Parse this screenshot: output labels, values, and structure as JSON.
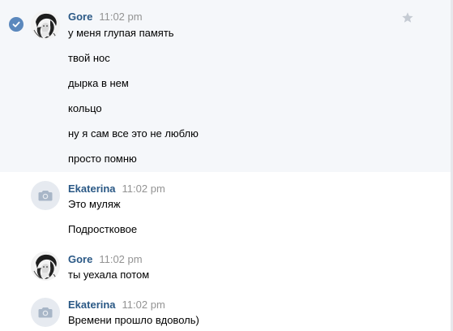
{
  "colors": {
    "author": "#2a5885",
    "time": "#939393",
    "text": "#000000",
    "selected_background": "#f5f7fa",
    "check": "#5b88bd",
    "star": "#c5cbd3",
    "camera_avatar": "#e6eaf0"
  },
  "messages": [
    {
      "author": "Gore",
      "time": "11:02 pm",
      "avatar": "photo",
      "selected": true,
      "lines": [
        "у меня глупая память",
        "твой нос",
        "дырка в нем",
        "кольцо",
        "ну я сам все это не люблю",
        "просто помню"
      ]
    },
    {
      "author": "Ekaterina",
      "time": "11:02 pm",
      "avatar": "camera-icon",
      "lines": [
        "Это муляж",
        "Подростковое"
      ]
    },
    {
      "author": "Gore",
      "time": "11:02 pm",
      "avatar": "photo",
      "lines": [
        "ты уехала потом"
      ]
    },
    {
      "author": "Ekaterina",
      "time": "11:02 pm",
      "avatar": "camera-icon",
      "lines": [
        "Времени прошло вдоволь)"
      ]
    }
  ],
  "icons": {
    "check": "check-circle-icon",
    "star": "star-icon",
    "camera": "camera-icon"
  }
}
